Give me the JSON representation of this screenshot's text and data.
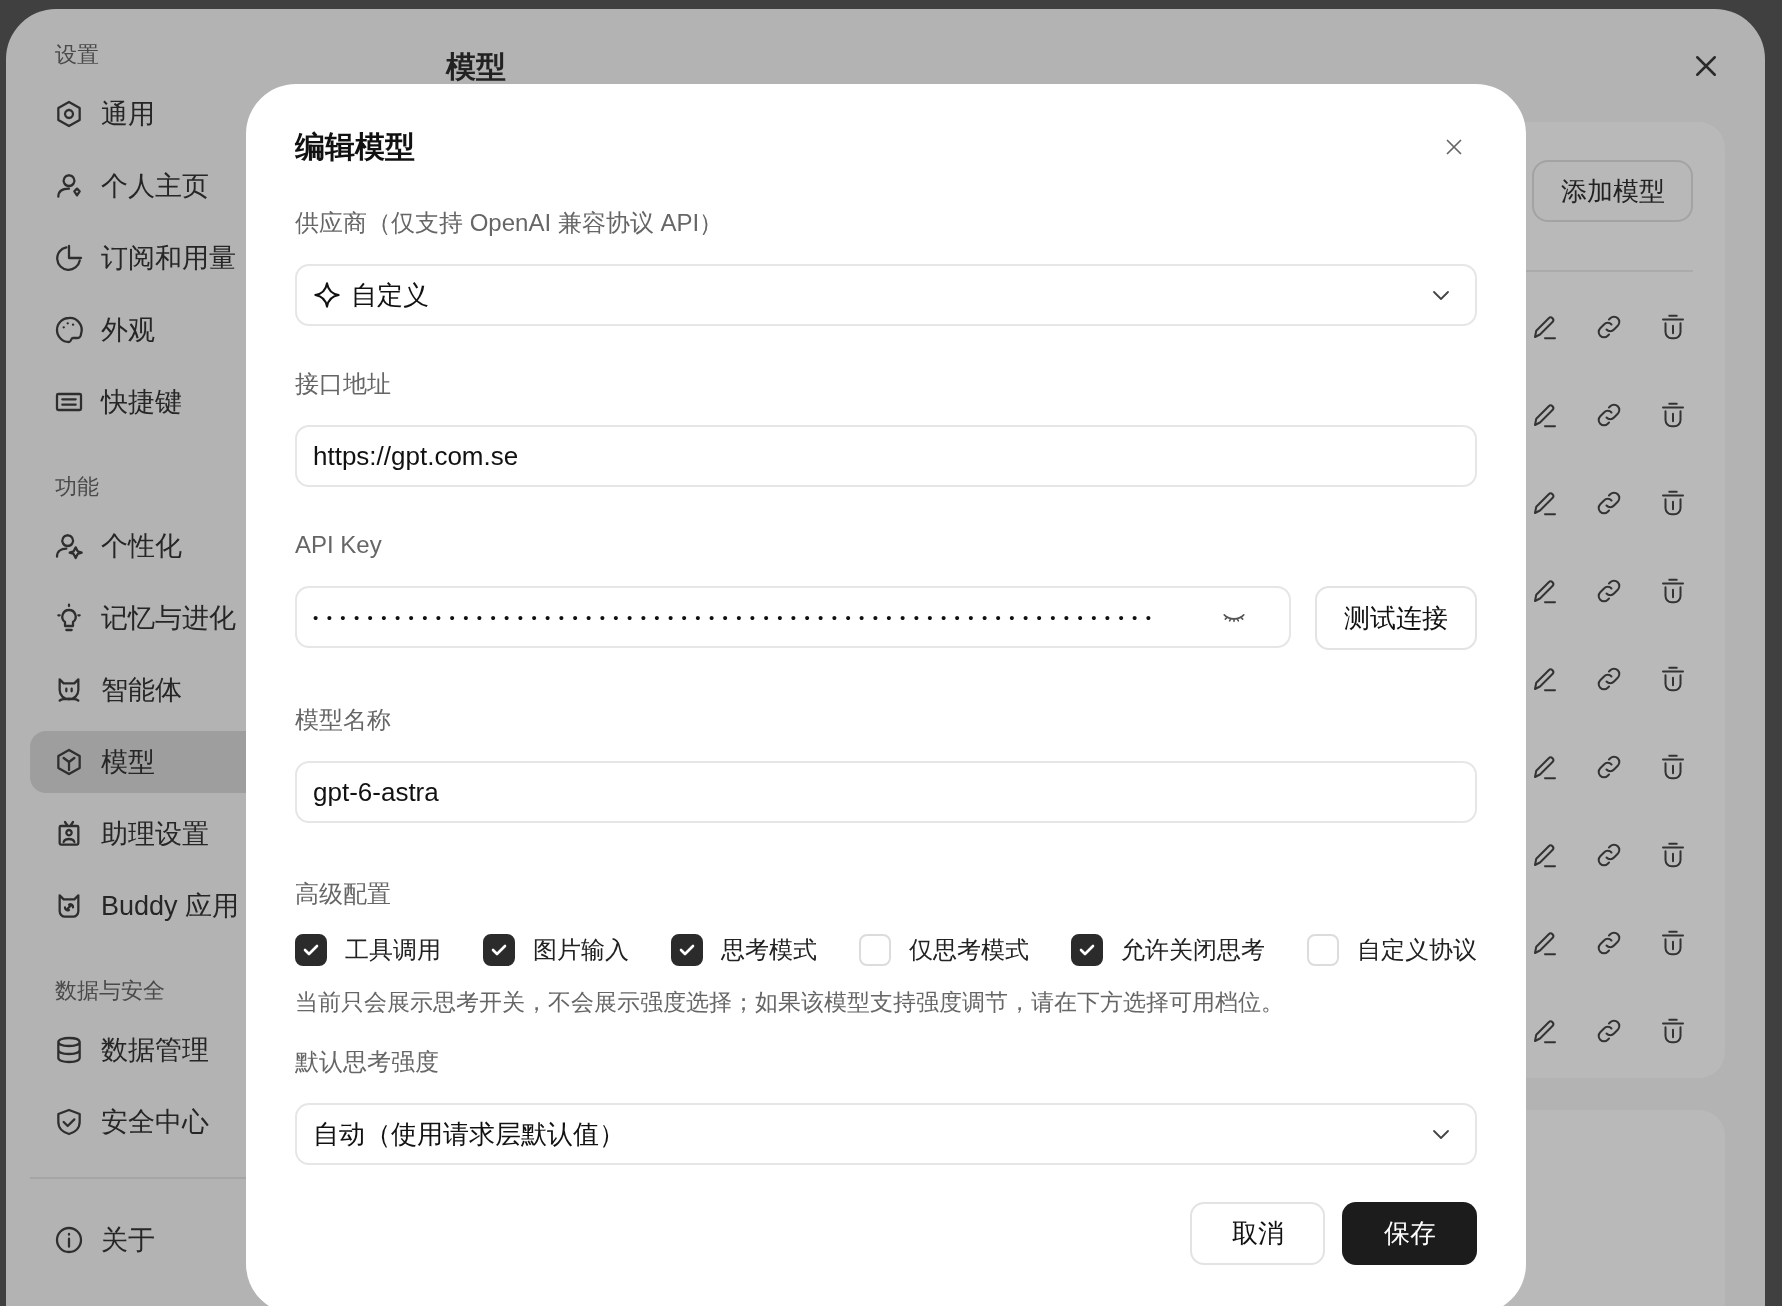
{
  "sidebar": {
    "sections": [
      {
        "title": "设置",
        "items": [
          {
            "label": "通用",
            "selected": false
          },
          {
            "label": "个人主页",
            "selected": false
          },
          {
            "label": "订阅和用量",
            "selected": false
          },
          {
            "label": "外观",
            "selected": false
          },
          {
            "label": "快捷键",
            "selected": false
          }
        ]
      },
      {
        "title": "功能",
        "items": [
          {
            "label": "个性化",
            "selected": false
          },
          {
            "label": "记忆与进化",
            "selected": false
          },
          {
            "label": "智能体",
            "selected": false
          },
          {
            "label": "模型",
            "selected": true
          },
          {
            "label": "助理设置",
            "selected": false
          },
          {
            "label": "Buddy 应用",
            "selected": false
          }
        ]
      },
      {
        "title": "数据与安全",
        "items": [
          {
            "label": "数据管理",
            "selected": false
          },
          {
            "label": "安全中心",
            "selected": false
          }
        ]
      }
    ],
    "footer_items": [
      {
        "label": "关于",
        "selected": false
      }
    ]
  },
  "page": {
    "title": "模型",
    "add_button": "添加模型",
    "model_rows": [
      {
        "kind": "actions"
      },
      {
        "kind": "actions"
      },
      {
        "kind": "actions"
      },
      {
        "kind": "actions"
      },
      {
        "kind": "actions"
      },
      {
        "kind": "actions"
      },
      {
        "kind": "actions"
      },
      {
        "kind": "actions"
      },
      {
        "kind": "actions"
      }
    ]
  },
  "dialog": {
    "title": "编辑模型",
    "fields": [
      {
        "kind": "provider-select",
        "label": "供应商（仅支持 OpenAI 兼容协议 API）",
        "value": "自定义"
      },
      {
        "kind": "text",
        "label": "接口地址",
        "value": "https://gpt.com.se"
      },
      {
        "kind": "secret",
        "label": "API Key",
        "value": "••••••••••••••••••••••••••••••••••••••••••••••••••••••••••••••",
        "button": "测试连接"
      },
      {
        "kind": "text",
        "label": "模型名称",
        "value": "gpt-6-astra"
      }
    ],
    "advanced": {
      "label": "高级配置",
      "options": [
        {
          "label": "工具调用",
          "checked": true
        },
        {
          "label": "图片输入",
          "checked": true
        },
        {
          "label": "思考模式",
          "checked": true
        },
        {
          "label": "仅思考模式",
          "checked": false
        },
        {
          "label": "允许关闭思考",
          "checked": true
        },
        {
          "label": "自定义协议",
          "checked": false
        }
      ],
      "hint": "当前只会展示思考开关，不会展示强度选择；如果该模型支持强度调节，请在下方选择可用档位。"
    },
    "effort": {
      "label": "默认思考强度",
      "value": "自动（使用请求层默认值）"
    },
    "buttons": [
      {
        "label": "取消",
        "kind": "secondary"
      },
      {
        "label": "保存",
        "kind": "primary"
      }
    ]
  }
}
